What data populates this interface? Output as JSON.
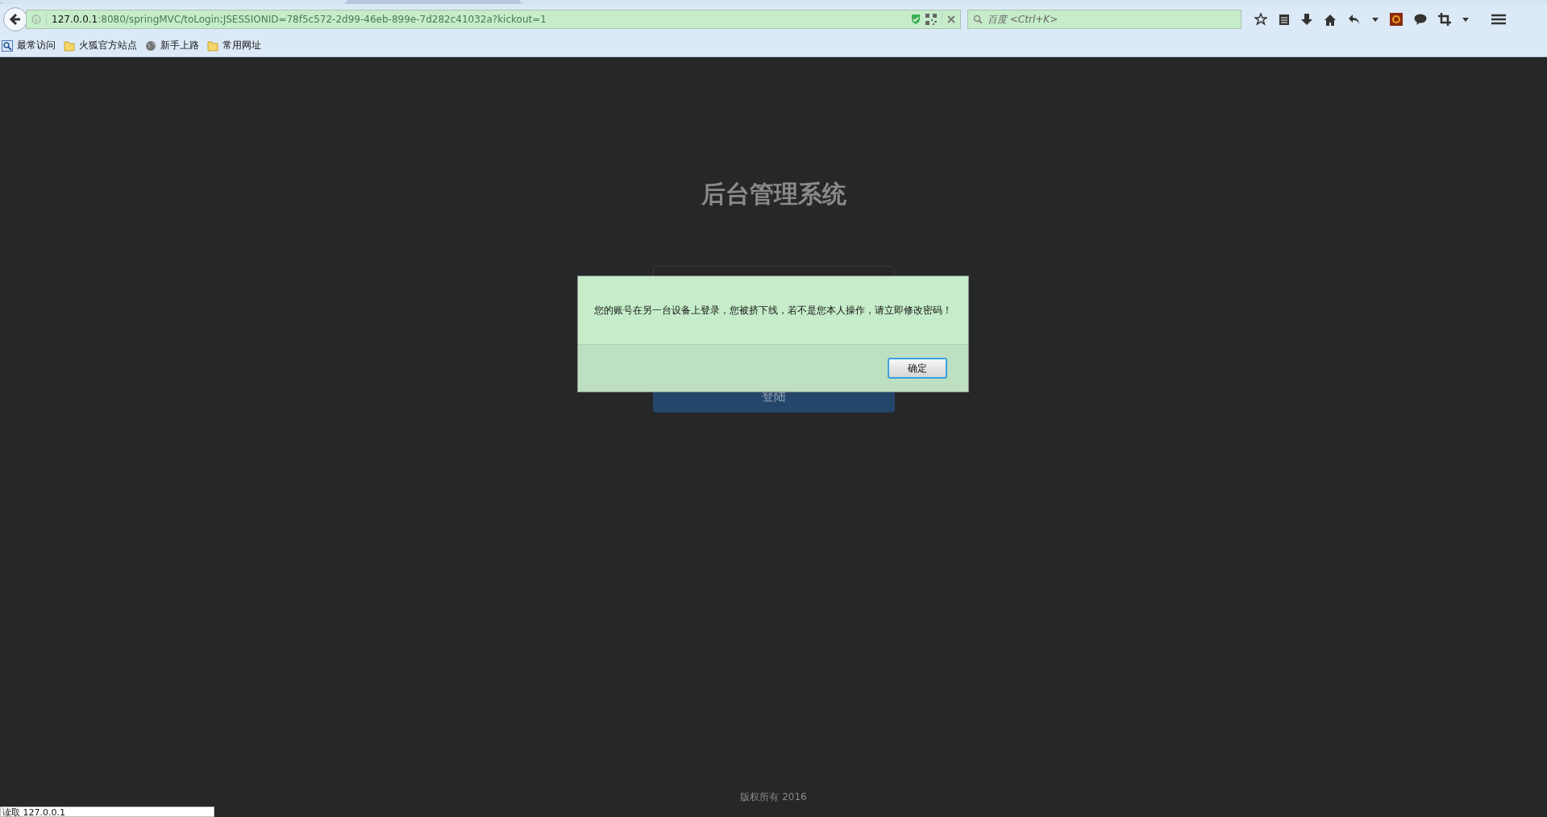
{
  "browser": {
    "url_host": "127.0.0.1",
    "url_path": ":8080/springMVC/toLogin;JSESSIONID=78f5c572-2d99-46eb-899e-7d282c41032a?kickout=1",
    "search_placeholder": "百度 <Ctrl+K>"
  },
  "bookmarks": [
    {
      "label": "最常访问",
      "kind": "smart"
    },
    {
      "label": "火狐官方站点",
      "kind": "folder"
    },
    {
      "label": "新手上路",
      "kind": "globe"
    },
    {
      "label": "常用网址",
      "kind": "folder"
    }
  ],
  "page": {
    "title": "后台管理系统",
    "login_button": "登陆",
    "footer": "版权所有 2016"
  },
  "dialog": {
    "message": "您的账号在另一台设备上登录，您被挤下线，若不是您本人操作，请立即修改密码！",
    "button": "确定"
  },
  "status_bar": "读取 127.0.0.1"
}
